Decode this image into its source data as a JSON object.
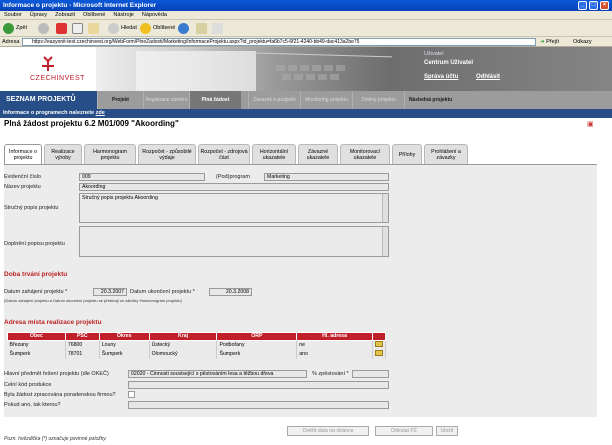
{
  "window": {
    "title": "Informace o projektu - Microsoft Internet Explorer"
  },
  "menu": [
    "Soubor",
    "Úpravy",
    "Zobrazit",
    "Oblíbené",
    "Nástroje",
    "Nápověda"
  ],
  "toolbar": {
    "back": "Zpět",
    "search": "Hledat",
    "favorites": "Oblíbené"
  },
  "address": {
    "label": "Adresa",
    "url": "https://easyonit-test.czechinvest.org/WebForm/PlneZadosti/Marketing/InformaceProjektu.aspx?id_projektu=fa6b7c5-6f21-4240-bb49-dac413a2be75",
    "go": "Přejít",
    "links": "Odkazy"
  },
  "brand": {
    "logo": "CZECHINVEST"
  },
  "user": {
    "label": "Uživatel",
    "name": "Centrum Uživatel",
    "account": "Správa účtu",
    "logout": "Odhlásit"
  },
  "nav": {
    "title": "SEZNAM PROJEKTŮ",
    "items": [
      "Projekt",
      "Registrace záměru",
      "Plná žádost",
      "Závazek o podpoře",
      "Monitoring projektu",
      "Změny projektu",
      "Následná projektu"
    ]
  },
  "info": {
    "text": "Informace o programech naleznete",
    "link": "zde"
  },
  "page": {
    "title": "Plná žádost projektu 6.2 M01/009 \"Akoording\""
  },
  "tabs": [
    "Informace o projektu",
    "Realizace výroby",
    "Harmonogram projektu",
    "Rozpočet - způsobilé výdaje",
    "Rozpočet - zdrojová část",
    "Horizontální ukazatele",
    "Závazné ukazatele",
    "Monitorovací ukazatele",
    "Přílohy",
    "Prohlášení a závazky"
  ],
  "form": {
    "evidencni_label": "Evidenční číslo",
    "evidencni_value": "009",
    "podprogram_label": "(Pod)program",
    "podprogram_value": "Marketing",
    "nazev_label": "Název projektu",
    "nazev_value": "Akoording",
    "popis_label": "Stručný popis projektu",
    "popis_value": "Stručný popis projektu Akoording",
    "doplneni_label": "Doplnění popisu projektu",
    "doplneni_value": ""
  },
  "doba": {
    "section": "Doba trvání projektu",
    "start_label": "Datum zahájení projektu *",
    "start_value": "20.3.2007",
    "end_label": "Datum ukončení projektu *",
    "end_value": "20.3.2008",
    "note": "(Datum zahájení projektu a Datum ukončení projektu se přebírají ze záložky Harmonogram projektu)"
  },
  "adresa": {
    "section": "Adresa místa realizace projektu",
    "columns": [
      "Obec",
      "PSČ",
      "Okres",
      "Kraj",
      "ORP",
      "Hl. adresa"
    ],
    "rows": [
      [
        "Březany",
        "76800",
        "Louny",
        "Ústecký",
        "Podbořany",
        "ne"
      ],
      [
        "Šumperk",
        "78701",
        "Šumperk",
        "Olomoucký",
        "Šumperk",
        "ano"
      ]
    ]
  },
  "extra": {
    "predmet_label": "Hlavní předmět řešení projektu (dle OKEČ)",
    "predmet_value": "02020 - Činnosti související s pěstováním lesa a těžbou dřeva",
    "procento_label": "% zpěstování *",
    "celni_label": "Celní kód produkce",
    "poradenska_label": "Byla žádost zpracována poradenskou firmou?",
    "pokud_label": "Pokud ano, tak kterou?"
  },
  "buttons": {
    "overit": "Ověřit data na stránce",
    "odeslat": "Odeslat PŽ",
    "ulozit": "Uložit"
  },
  "footer": {
    "note": "Pozn. hvězdička (*) označuje povinné položky."
  },
  "colors": {
    "navy": "#274e86",
    "accent": "#c0202a",
    "xp_blue": "#0a59d8"
  }
}
